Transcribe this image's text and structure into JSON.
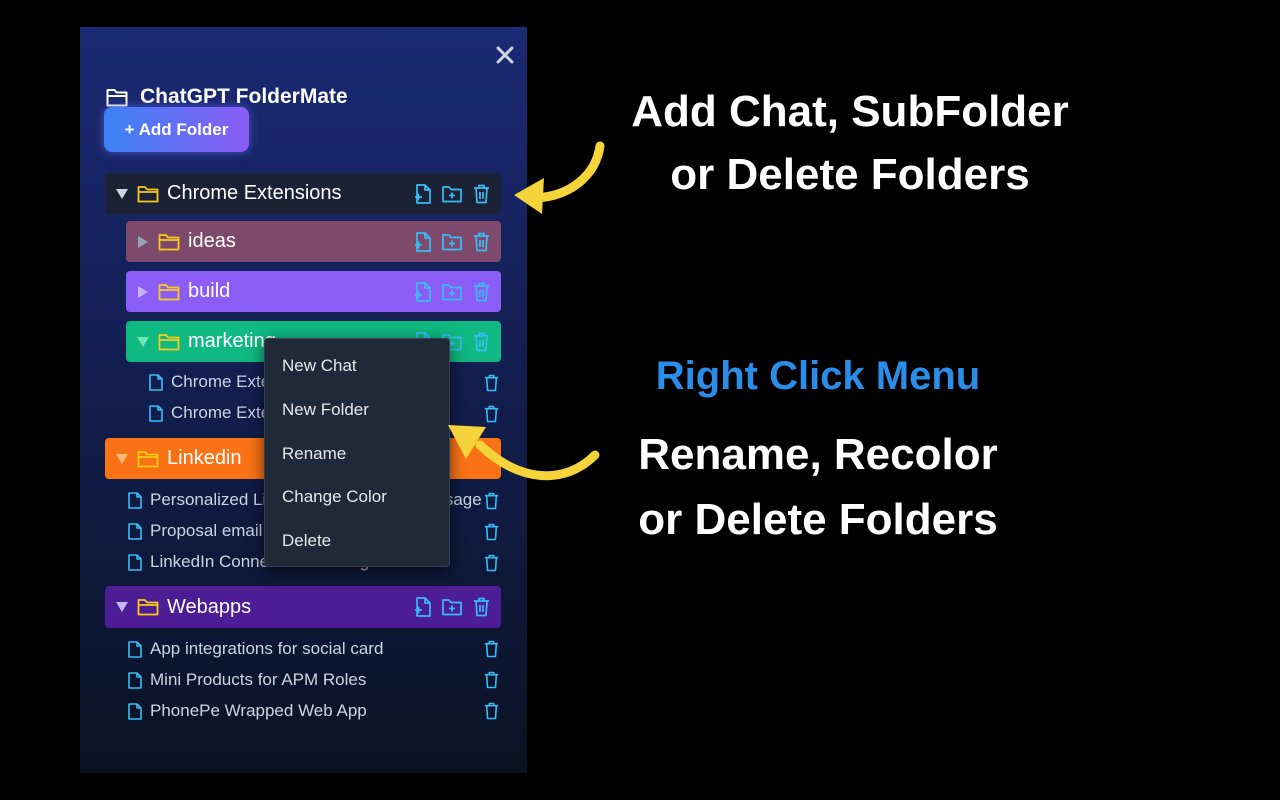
{
  "colors": {
    "accent": "#38bdf8",
    "folder_icon": "#facc15",
    "arrow": "#f5d33a",
    "menu_heading": "#2a8ee8"
  },
  "panel": {
    "title": "ChatGPT FolderMate",
    "add_folder_label": "+ Add Folder"
  },
  "folders": {
    "chrome": {
      "name": "Chrome Extensions",
      "color": "#1b2235",
      "expanded": true,
      "subfolders": {
        "ideas": {
          "name": "ideas",
          "color": "#7d4a6c",
          "expanded": false
        },
        "build": {
          "name": "build",
          "color": "#8b5cf6",
          "expanded": false
        },
        "marketing": {
          "name": "marketing",
          "color": "#10b981",
          "expanded": true,
          "chats": [
            "Chrome Extension Marketing",
            "Chrome Extension Launch"
          ]
        }
      }
    },
    "linkedin": {
      "name": "Linkedin",
      "color": "#f97316",
      "expanded": true,
      "chats": [
        "Personalized LinkedIn Connection Message",
        "Proposal email",
        "LinkedIn Connection Message Guide"
      ]
    },
    "webapps": {
      "name": "Webapps",
      "color": "#4c1d95",
      "expanded": true,
      "chats": [
        "App integrations for social card",
        "Mini Products for APM Roles",
        "PhonePe Wrapped Web App"
      ]
    }
  },
  "context_menu": {
    "items": [
      "New Chat",
      "New Folder",
      "Rename",
      "Change Color",
      "Delete"
    ]
  },
  "annotations": {
    "top_line1": "Add Chat, SubFolder",
    "top_line2": "or Delete Folders",
    "menu_heading": "Right Click Menu",
    "bottom_line1": "Rename, Recolor",
    "bottom_line2": "or Delete Folders"
  }
}
